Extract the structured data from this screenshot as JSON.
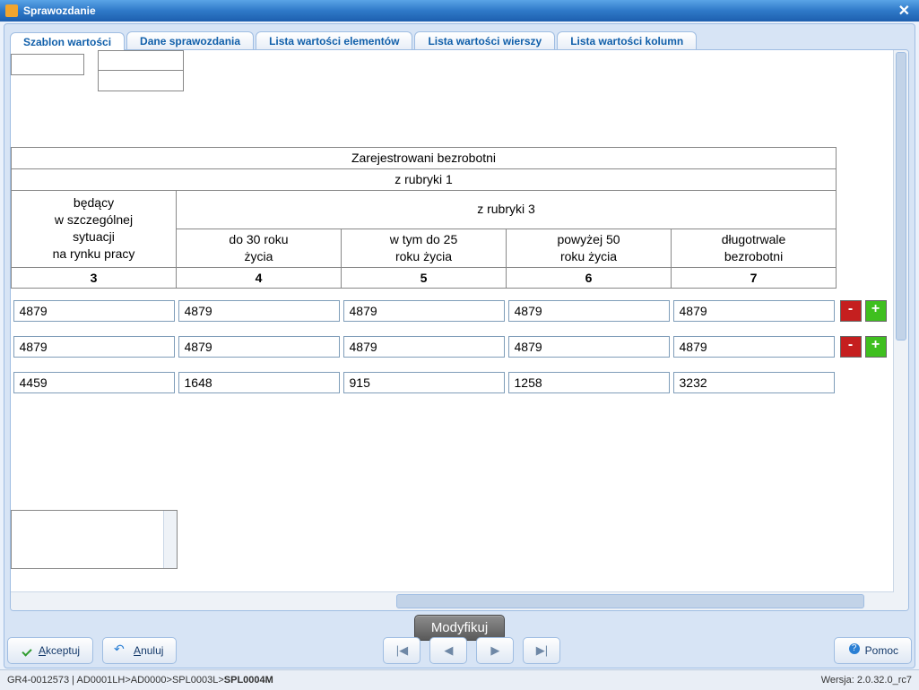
{
  "window": {
    "title": "Sprawozdanie"
  },
  "tabs": [
    "Szablon wartości",
    "Dane sprawozdania",
    "Lista wartości elementów",
    "Lista wartości wierszy",
    "Lista wartości kolumn"
  ],
  "headers": {
    "top": "Zarejestrowani bezrobotni",
    "sub1": "z rubryki 1",
    "col3_multi": "będący\nw szczególnej\nsytuacji\nna rynku pracy",
    "sub3": "z rubryki 3",
    "col4": "do 30 roku\nżycia",
    "col5": "w tym do 25\nroku życia",
    "col6": "powyżej 50\nroku życia",
    "col7": "długotrwale\nbezrobotni"
  },
  "colnums": [
    "3",
    "4",
    "5",
    "6",
    "7"
  ],
  "rows": [
    {
      "vals": [
        "4879",
        "4879",
        "4879",
        "4879",
        "4879"
      ],
      "buttons": true
    },
    {
      "vals": [
        "4879",
        "4879",
        "4879",
        "4879",
        "4879"
      ],
      "buttons": true
    },
    {
      "vals": [
        "4459",
        "1648",
        "915",
        "1258",
        "3232"
      ],
      "buttons": false
    }
  ],
  "modify": "Modyfikuj",
  "footer": {
    "accept": "Akceptuj",
    "accept_ul": "A",
    "cancel": "Anuluj",
    "cancel_ul": "A",
    "help": "Pomoc"
  },
  "nav_icons": {
    "first": "|◀",
    "prev": "◀",
    "next": "▶",
    "last": "▶|"
  },
  "status": {
    "left_parts": [
      "GR4-0012573",
      " | ",
      "AD0001LH",
      ">",
      "AD0000",
      ">",
      "SPL0003L",
      ">"
    ],
    "left_bold": "SPL0004M",
    "right": "Wersja: 2.0.32.0_rc7"
  },
  "chart_data": {
    "type": "table",
    "title": "Zarejestrowani bezrobotni",
    "columns": [
      {
        "num": "3",
        "label": "będący w szczególnej sytuacji na rynku pracy (z rubryki 1)"
      },
      {
        "num": "4",
        "label": "do 30 roku życia (z rubryki 3)"
      },
      {
        "num": "5",
        "label": "w tym do 25 roku życia (z rubryki 3)"
      },
      {
        "num": "6",
        "label": "powyżej 50 roku życia (z rubryki 3)"
      },
      {
        "num": "7",
        "label": "długotrwale bezrobotni (z rubryki 3)"
      }
    ],
    "rows": [
      [
        4879,
        4879,
        4879,
        4879,
        4879
      ],
      [
        4879,
        4879,
        4879,
        4879,
        4879
      ],
      [
        4459,
        1648,
        915,
        1258,
        3232
      ]
    ]
  }
}
